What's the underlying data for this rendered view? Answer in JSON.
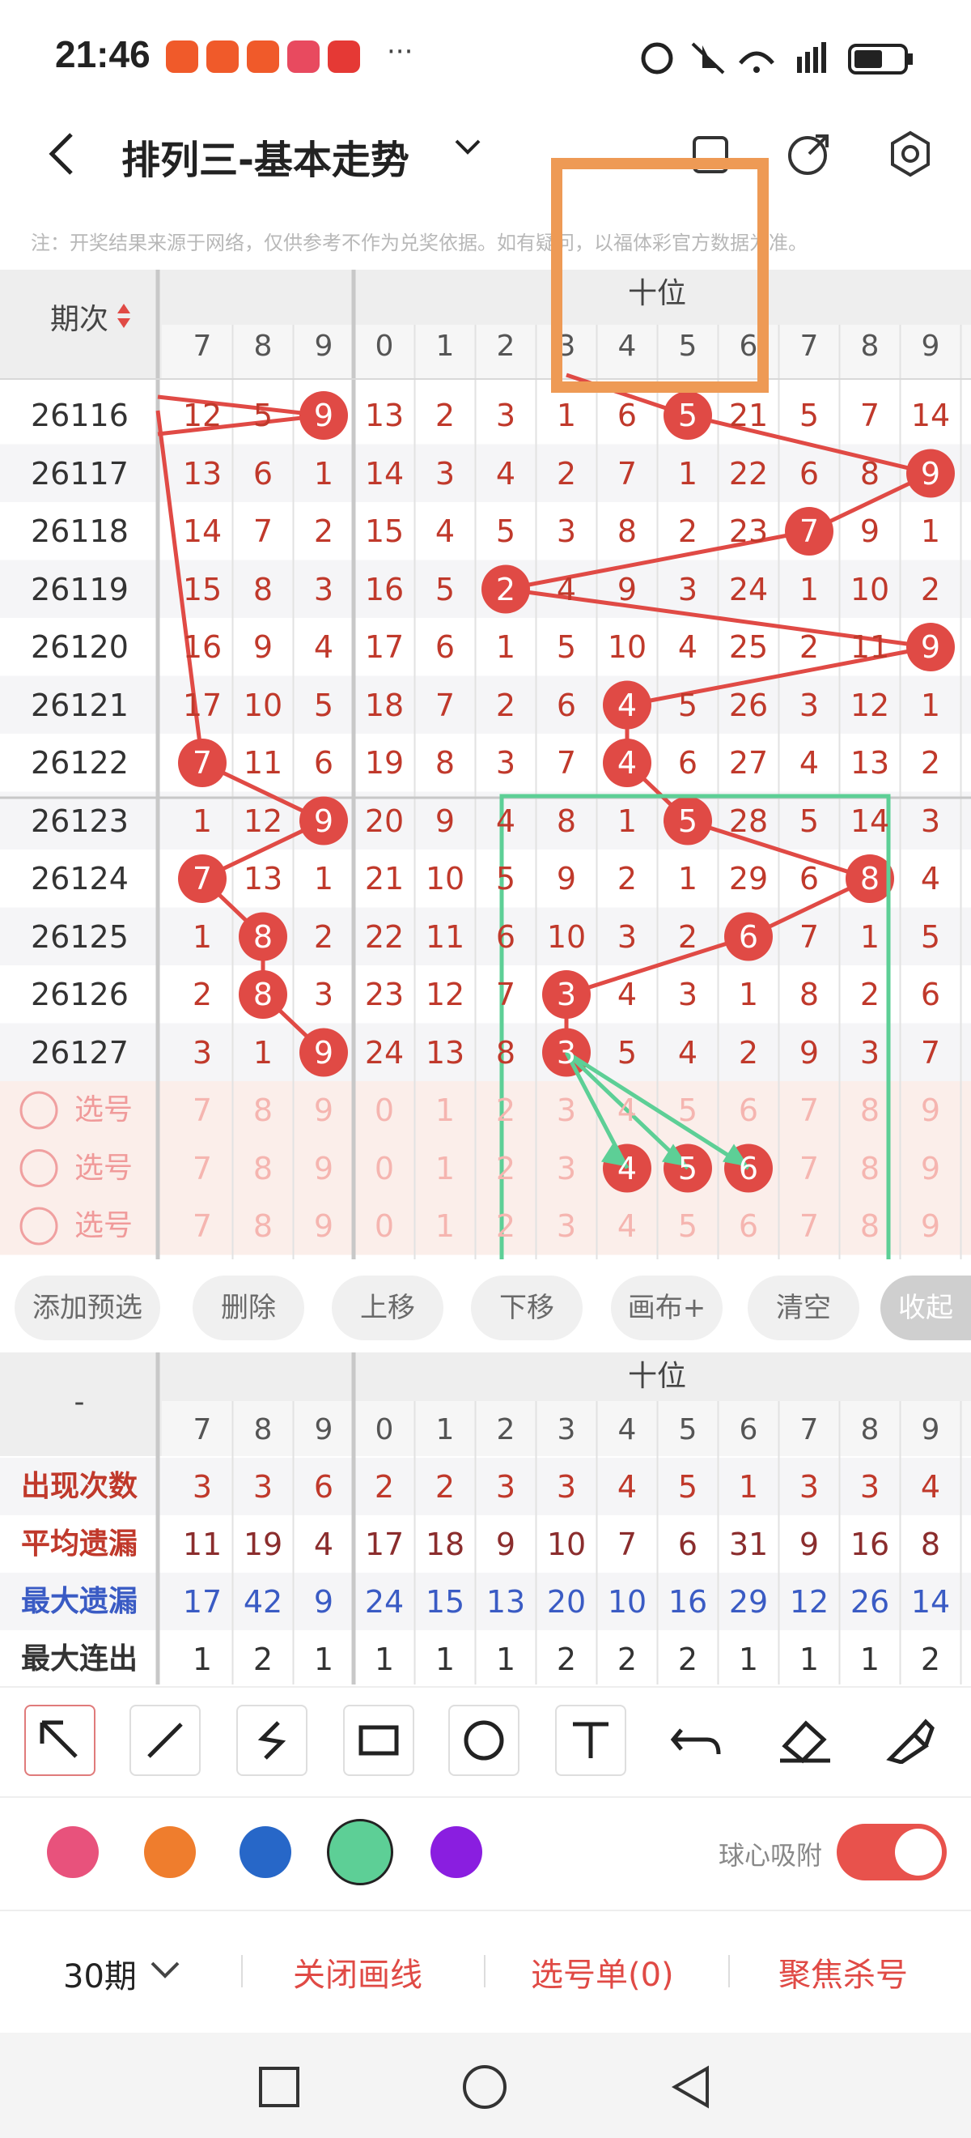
{
  "status": {
    "time": "21:46",
    "more": "···"
  },
  "header": {
    "title": "排列三-基本走势",
    "notice": "注：开奖结果来源于网络，仅供参考不作为兑奖依据。如有疑问，以福体彩官方数据为准。"
  },
  "table": {
    "period_label": "期次",
    "section_label": "十位",
    "left_cols": [
      "7",
      "8",
      "9"
    ],
    "right_cols": [
      "0",
      "1",
      "2",
      "3",
      "4",
      "5",
      "6",
      "7",
      "8",
      "9"
    ],
    "rows": [
      {
        "period": "26116",
        "left": [
          "12",
          "5",
          "9"
        ],
        "right": [
          "13",
          "2",
          "3",
          "1",
          "6",
          "5",
          "21",
          "5",
          "7",
          "14"
        ]
      },
      {
        "period": "26117",
        "left": [
          "13",
          "6",
          "1"
        ],
        "right": [
          "14",
          "3",
          "4",
          "2",
          "7",
          "1",
          "22",
          "6",
          "8",
          "9"
        ]
      },
      {
        "period": "26118",
        "left": [
          "14",
          "7",
          "2"
        ],
        "right": [
          "15",
          "4",
          "5",
          "3",
          "8",
          "2",
          "23",
          "7",
          "9",
          "1"
        ]
      },
      {
        "period": "26119",
        "left": [
          "15",
          "8",
          "3"
        ],
        "right": [
          "16",
          "5",
          "2",
          "4",
          "9",
          "3",
          "24",
          "1",
          "10",
          "2"
        ]
      },
      {
        "period": "26120",
        "left": [
          "16",
          "9",
          "4"
        ],
        "right": [
          "17",
          "6",
          "1",
          "5",
          "10",
          "4",
          "25",
          "2",
          "11",
          "9"
        ]
      },
      {
        "period": "26121",
        "left": [
          "17",
          "10",
          "5"
        ],
        "right": [
          "18",
          "7",
          "2",
          "6",
          "4",
          "5",
          "26",
          "3",
          "12",
          "1"
        ]
      },
      {
        "period": "26122",
        "left": [
          "7",
          "11",
          "6"
        ],
        "right": [
          "19",
          "8",
          "3",
          "7",
          "4",
          "6",
          "27",
          "4",
          "13",
          "2"
        ]
      },
      {
        "period": "26123",
        "left": [
          "1",
          "12",
          "9"
        ],
        "right": [
          "20",
          "9",
          "4",
          "8",
          "1",
          "5",
          "28",
          "5",
          "14",
          "3"
        ]
      },
      {
        "period": "26124",
        "left": [
          "7",
          "13",
          "1"
        ],
        "right": [
          "21",
          "10",
          "5",
          "9",
          "2",
          "1",
          "29",
          "6",
          "8",
          "4"
        ]
      },
      {
        "period": "26125",
        "left": [
          "1",
          "8",
          "2"
        ],
        "right": [
          "22",
          "11",
          "6",
          "10",
          "3",
          "2",
          "6",
          "7",
          "1",
          "5"
        ]
      },
      {
        "period": "26126",
        "left": [
          "2",
          "8",
          "3"
        ],
        "right": [
          "23",
          "12",
          "7",
          "3",
          "4",
          "3",
          "1",
          "8",
          "2",
          "6"
        ]
      },
      {
        "period": "26127",
        "left": [
          "3",
          "1",
          "9"
        ],
        "right": [
          "24",
          "13",
          "8",
          "3",
          "5",
          "4",
          "2",
          "9",
          "3",
          "7"
        ]
      }
    ],
    "pick_label": "选号"
  },
  "buttons": [
    "添加预选",
    "删除",
    "上移",
    "下移",
    "画布+",
    "清空",
    "收起"
  ],
  "stats": {
    "section_label": "十位",
    "dash": "-",
    "rows": [
      {
        "label": "出现次数",
        "left": [
          "3",
          "3",
          "6"
        ],
        "right": [
          "2",
          "2",
          "3",
          "3",
          "4",
          "5",
          "1",
          "3",
          "3",
          "4"
        ]
      },
      {
        "label": "平均遗漏",
        "left": [
          "11",
          "19",
          "4"
        ],
        "right": [
          "17",
          "18",
          "9",
          "10",
          "7",
          "6",
          "31",
          "9",
          "16",
          "8"
        ]
      },
      {
        "label": "最大遗漏",
        "left": [
          "17",
          "42",
          "9"
        ],
        "right": [
          "24",
          "15",
          "13",
          "20",
          "10",
          "16",
          "29",
          "12",
          "26",
          "14"
        ]
      },
      {
        "label": "最大连出",
        "left": [
          "1",
          "2",
          "1"
        ],
        "right": [
          "1",
          "1",
          "1",
          "2",
          "2",
          "2",
          "1",
          "1",
          "1",
          "2"
        ]
      }
    ]
  },
  "toolbar": {
    "icons": [
      "arrow-tool-icon",
      "line-tool-icon",
      "freehand-tool-icon",
      "rectangle-tool-icon",
      "circle-tool-icon",
      "text-tool-icon",
      "undo-icon",
      "eraser-icon",
      "clear-brush-icon"
    ]
  },
  "colors": {
    "pink": "#e8527c",
    "orange": "#ef7d2d",
    "blue": "#2767c8",
    "green": "#5dcf96",
    "purple": "#8a1ee0",
    "red": "#e04a45"
  },
  "snap_label": "球心吸附",
  "bottom": {
    "periods": "30期",
    "close_draw": "关闭画线",
    "pick_list": "选号单(0)",
    "focus_kill": "聚焦杀号"
  }
}
